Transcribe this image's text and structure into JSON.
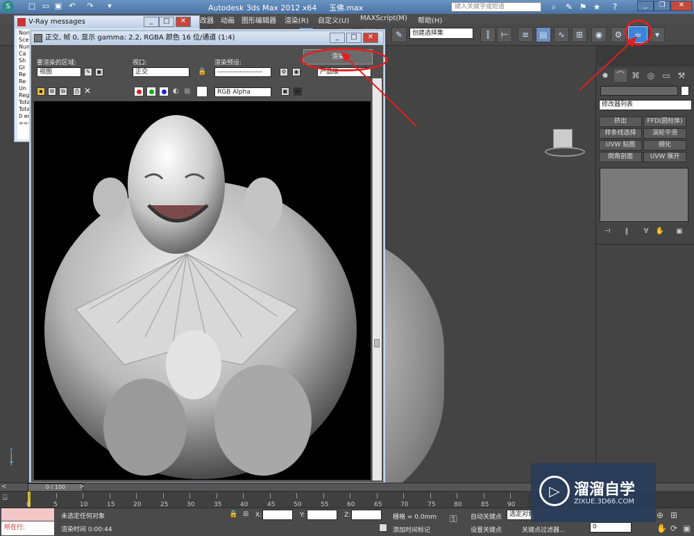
{
  "titlebar": {
    "app_title": "Autodesk 3ds Max  2012 x64",
    "file_name": "玉佛.max",
    "search_placeholder": "键入关键字或短语",
    "help_label": "?"
  },
  "menu": [
    "修改器",
    "动画",
    "图形编辑器",
    "渲染(R)",
    "自定义(U)",
    "MAXScript(M)",
    "帮助(H)"
  ],
  "toolbar": {
    "selection_set": "创建选择集",
    "render_icon": "teapot-render-icon"
  },
  "vray_window": {
    "title": "V-Ray messages",
    "lines": [
      "Non",
      "Scen",
      "Num",
      "Ca",
      "Sh",
      "GI",
      "Re",
      "Re",
      "Un",
      "Reg",
      "Tota",
      "Tota",
      "0 em",
      "===="
    ]
  },
  "render_frame": {
    "title": "正交, 帧 0, 显示 gamma: 2.2, RGBA 颜色 16 位/通道 (1:4)",
    "area_label": "要渲染的区域:",
    "area_value": "视图",
    "viewport_label": "视口:",
    "viewport_value": "正交",
    "preset_label": "渲染预设:",
    "preset_value": "--------------------",
    "render_button": "渲染",
    "quality_value": "产品级",
    "channel_value": "RGB Alpha"
  },
  "command_panel": {
    "modifier_list": "修改器列表",
    "buttons": [
      [
        "挤出",
        "FFD(圆柱体)"
      ],
      [
        "样条线选择",
        "涡轮平滑"
      ],
      [
        "UVW 贴图",
        "细化"
      ],
      [
        "倒角剖面",
        "UVW 展开"
      ]
    ]
  },
  "timeline": {
    "frame_readout": "0 / 100",
    "ticks": [
      "0",
      "5",
      "10",
      "15",
      "20",
      "25",
      "30",
      "35",
      "40",
      "45",
      "50",
      "55",
      "60",
      "65",
      "70",
      "75",
      "80",
      "85",
      "90"
    ]
  },
  "status": {
    "script_label": "所在行:",
    "no_selection": "未选定任何对象",
    "render_time": "渲染时间  0:00:44",
    "x_label": "X:",
    "y_label": "Y:",
    "z_label": "Z:",
    "grid": "栅格 = 0.0mm",
    "add_time_tag": "添加时间标记",
    "auto_key": "自动关键点",
    "selected": "选定对象",
    "set_key": "设置关键点",
    "key_filters": "关键点过滤器...",
    "frame_value": "0"
  },
  "watermark": {
    "brand": "溜溜自学",
    "url": "ZIXUE.3D66.COM"
  },
  "colors": {
    "accent": "#e02020",
    "titlebar": "#4a73a4"
  }
}
